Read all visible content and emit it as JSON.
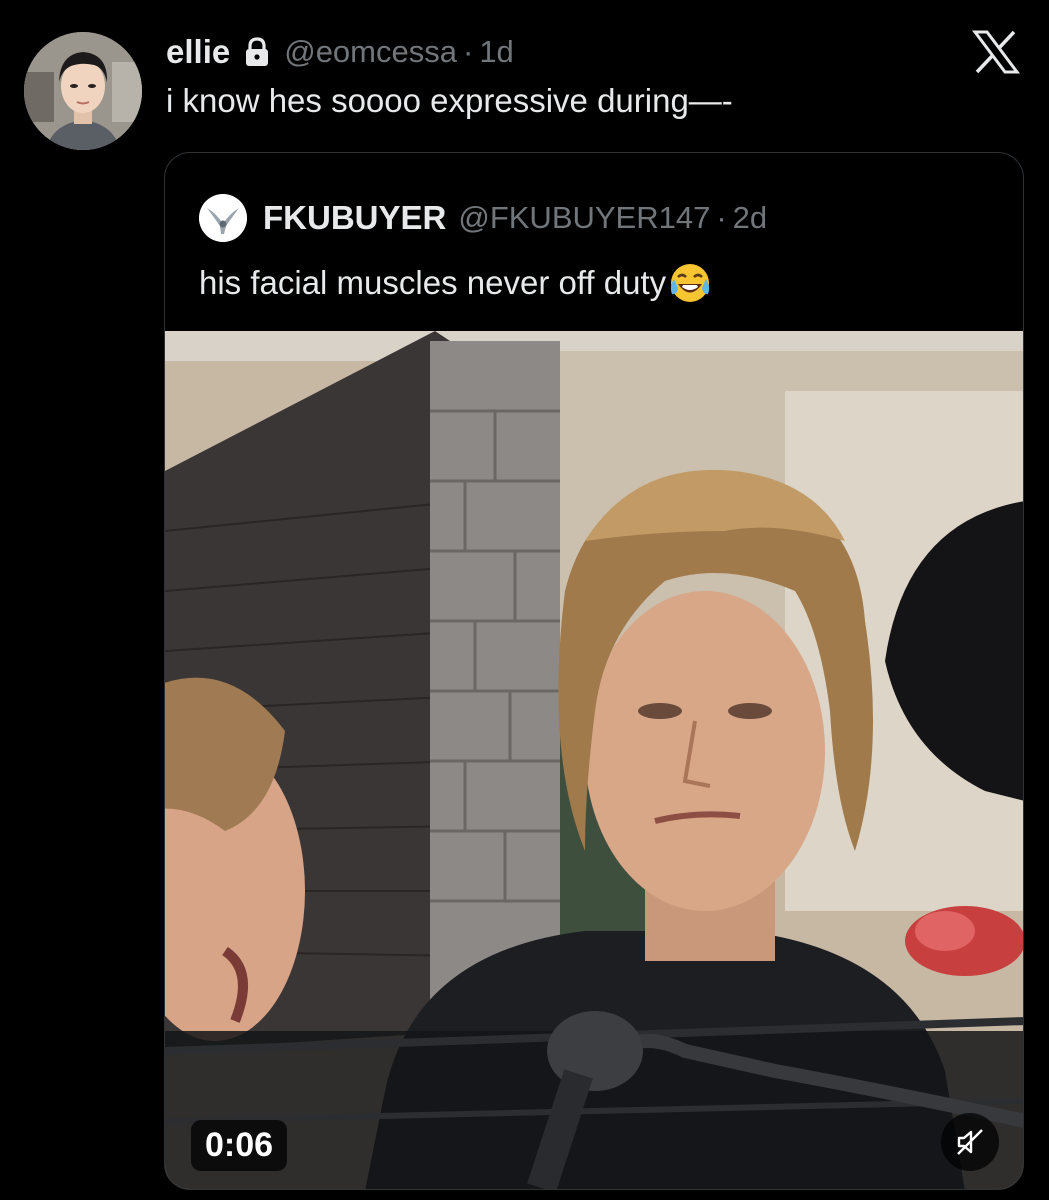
{
  "tweet": {
    "display_name": "ellie",
    "handle": "@eomcessa",
    "separator": "·",
    "time": "1d",
    "text": "i know hes soooo expressive during—-",
    "lock_icon": "lock-icon",
    "brand_icon": "x-logo-icon"
  },
  "quote": {
    "display_name": "FKUBUYER",
    "handle": "@FKUBUYER147",
    "separator": "·",
    "time": "2d",
    "text": "his facial muscles never off duty",
    "emoji": "face-with-tears-of-joy",
    "media": {
      "type": "video",
      "timestamp": "0:06",
      "muted_icon": "speaker-muted-icon"
    }
  },
  "colors": {
    "background": "#000000",
    "primary_text": "#e7e9ea",
    "secondary_text": "#71767b",
    "border": "#2f3336"
  }
}
